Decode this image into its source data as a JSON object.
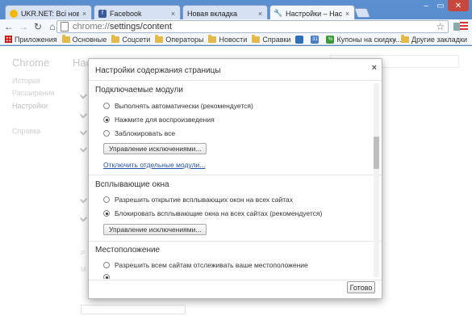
{
  "tabs": [
    {
      "title": "UKR.NET: Всі новини Ук",
      "favicon_color": "#f5b800",
      "favicon": "ukrnet-icon",
      "active": false
    },
    {
      "title": "Facebook",
      "favicon_color": "#3b5998",
      "favicon": "facebook-icon",
      "active": false
    },
    {
      "title": "Новая вкладка",
      "favicon_color": "",
      "favicon": "",
      "active": false
    },
    {
      "title": "Настройки – Настройки",
      "favicon_color": "#666666",
      "favicon": "wrench-icon",
      "active": true
    }
  ],
  "toolbar": {
    "url_dim": "chrome://",
    "url_main": "settings/content"
  },
  "bookmarks": {
    "items": [
      {
        "label": "Приложения",
        "icon": "apps-grid-icon"
      },
      {
        "label": "Основные",
        "icon": "folder-icon"
      },
      {
        "label": "Соцсети",
        "icon": "folder-icon"
      },
      {
        "label": "Операторы",
        "icon": "folder-icon"
      },
      {
        "label": "Новости",
        "icon": "folder-icon"
      },
      {
        "label": "Справки",
        "icon": "folder-icon"
      },
      {
        "label": "Купоны на скидку...",
        "icon": "coupon-icon"
      }
    ],
    "other": "Другие закладки",
    "overflow": "»"
  },
  "settings_bg": {
    "side_title": "Chrome",
    "side_links": [
      "История",
      "Расширения",
      "Настройки",
      "Справка"
    ],
    "main_title": "Настройки"
  },
  "dialog": {
    "title": "Настройки содержания страницы",
    "close": "×",
    "plugins": {
      "title": "Подключаемые модули",
      "options": [
        "Выполнять автоматически (рекомендуется)",
        "Нажмите для воспроизведения",
        "Заблокировать все"
      ],
      "selected": 1,
      "manage": "Управление исключениями...",
      "disable_link": "Отключить отдельные модули..."
    },
    "popups": {
      "title": "Всплывающие окна",
      "options": [
        "Разрешить открытие всплывающих окон на всех сайтах",
        "Блокировать всплывающие окна на всех сайтах (рекомендуется)"
      ],
      "selected": 1,
      "manage": "Управление исключениями..."
    },
    "location": {
      "title": "Местоположение",
      "options": [
        "Разрешить всем сайтам отслеживать ваше местоположение"
      ]
    },
    "done": "Готово"
  }
}
